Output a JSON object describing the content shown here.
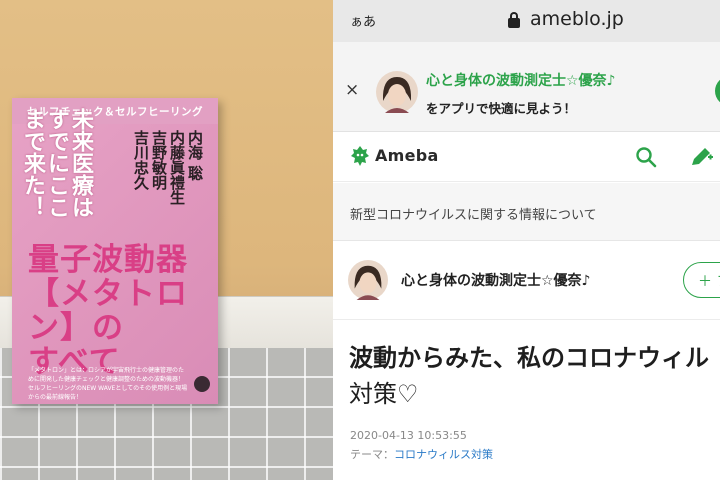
{
  "photo": {
    "book": {
      "series": "セルフチェック＆セルフヒーリング",
      "kicker": "未来医療はすでにここまで来た！",
      "authors": [
        "内海 聡",
        "内藤眞禮生",
        "吉野敏明",
        "吉川忠久"
      ],
      "title_lines": [
        "量子波動器",
        "【メタトロン】の",
        "すべて"
      ],
      "description": "「メタトロン」とは：ロシアが宇宙飛行士の健康管理のために開発した健康チェックと健康調整のための波動機器！セルフヒーリングのNEW WAVEとしてのその使用例と現場からの最前線報告！"
    }
  },
  "browser": {
    "text_size_label": "ぁあ",
    "host": "ameblo.jp"
  },
  "app_banner": {
    "close_label": "×",
    "blog_name": "心と身体の波動測定士☆優奈♪",
    "cta_text": "をアプリで快適に見よう！"
  },
  "header": {
    "logo_text": "Ameba",
    "icons": [
      "search-icon",
      "pen-icon"
    ]
  },
  "notice": {
    "text": "新型コロナウイルスに関する情報について"
  },
  "blog": {
    "name": "心と身体の波動測定士☆優奈♪",
    "follow_label": "＋ フ"
  },
  "article": {
    "title_line1": "波動からみた、私のコロナウィル",
    "title_line2": "対策♡",
    "date": "2020-04-13 10:53:55",
    "theme_label": "テーマ：",
    "theme_value": "コロナウィルス対策"
  },
  "colors": {
    "accent_green": "#2ca34a",
    "link_blue": "#2a7ac7",
    "book_pink": "#e7a3c6",
    "book_title_magenta": "#d93f86"
  }
}
